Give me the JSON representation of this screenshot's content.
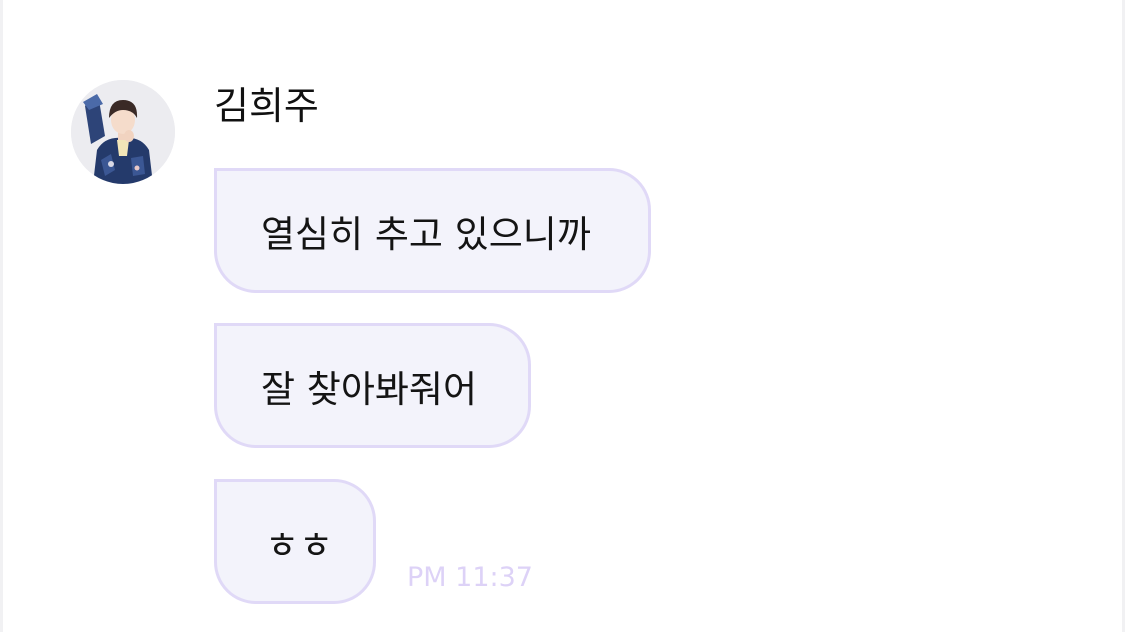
{
  "chat": {
    "sender": {
      "name": "김희주",
      "avatar": "profile-photo"
    },
    "messages": [
      {
        "text": "열심히 추고 있으니까"
      },
      {
        "text": "잘 찾아봐줘어"
      },
      {
        "text": "ㅎㅎ"
      }
    ],
    "timestamp": "PM 11:37"
  },
  "colors": {
    "bubble_bg": "#f3f3fb",
    "bubble_border": "#e0d9f7",
    "timestamp": "#ddd2f7",
    "text": "#141414"
  }
}
